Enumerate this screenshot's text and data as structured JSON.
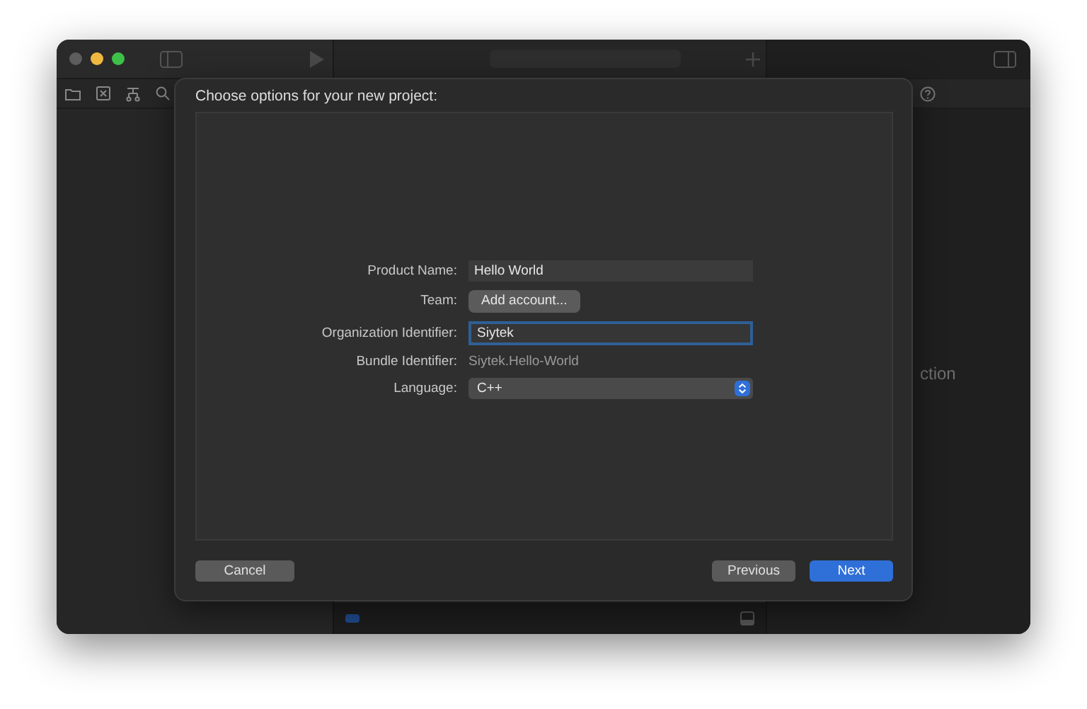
{
  "background_window": {
    "inspector_text": "ction"
  },
  "dialog": {
    "title": "Choose options for your new project:",
    "fields": [
      {
        "kind": "text_field",
        "label": "Product Name:",
        "value": "Hello World",
        "focused": false
      },
      {
        "kind": "button",
        "label": "Team:",
        "value": "Add account..."
      },
      {
        "kind": "text_field",
        "label": "Organization Identifier:",
        "value": "Siytek",
        "focused": true
      },
      {
        "kind": "static",
        "label": "Bundle Identifier:",
        "value": "Siytek.Hello-World"
      },
      {
        "kind": "popup",
        "label": "Language:",
        "value": "C++"
      }
    ],
    "buttons": [
      {
        "label": "Cancel",
        "kind": "cancel"
      },
      {
        "label": "Previous",
        "kind": "secondary"
      },
      {
        "label": "Next",
        "kind": "primary"
      }
    ]
  }
}
